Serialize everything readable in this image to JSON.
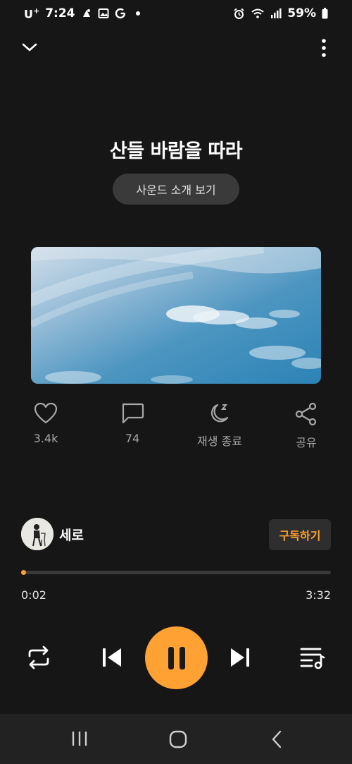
{
  "status": {
    "carrier": "U",
    "carrier_sup": "+",
    "time": "7:24",
    "battery": "59%"
  },
  "header": {
    "collapse_icon": "chevron-down-icon",
    "menu_icon": "more-vertical-icon"
  },
  "track": {
    "title": "산들 바람을 따라",
    "intro_button": "사운드 소개 보기"
  },
  "actions": [
    {
      "icon": "heart-icon",
      "label": "3.4k"
    },
    {
      "icon": "comment-icon",
      "label": "74"
    },
    {
      "icon": "sleep-timer-icon",
      "label": "재생 종료"
    },
    {
      "icon": "share-icon",
      "label": "공유"
    }
  ],
  "artist": {
    "name": "세로",
    "subscribe_label": "구독하기"
  },
  "player": {
    "current_time": "0:02",
    "total_time": "3:32",
    "progress": 0.01
  },
  "colors": {
    "accent": "#ffa233",
    "background": "#161616"
  }
}
